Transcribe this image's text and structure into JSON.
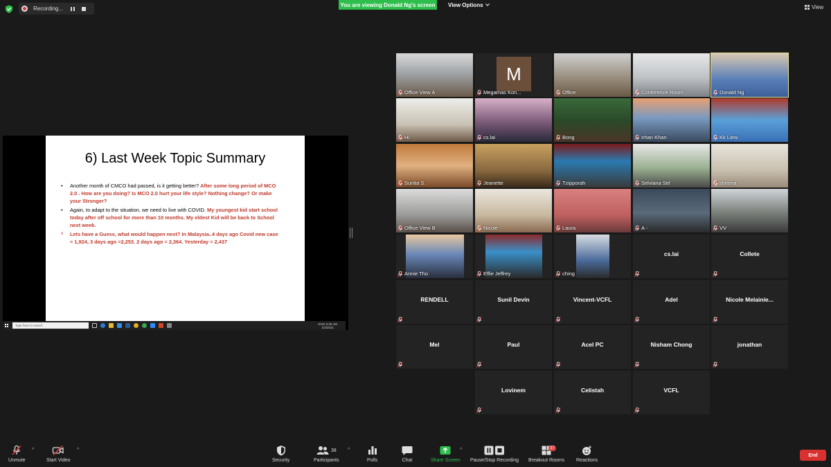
{
  "topbar": {
    "recording_label": "Recording...",
    "banner": "You are viewing Donald Ng's screen",
    "view_options": "View Options",
    "view_label": "View"
  },
  "colors": {
    "accent_green": "#2dbe4b",
    "end_red": "#d93030",
    "active_speaker": "#e8e89a"
  },
  "slide": {
    "title": "6) Last Week Topic Summary",
    "bullets": [
      {
        "normal": "Another month of CMCO had passed, is it getting better?  ",
        "red": "After some long period of MCO 2.0 .  How are you doing?  Is MCO 2.0 hurt your life style? Nothing change? Or make your Stronger?"
      },
      {
        "normal": "Again, to adapt to the situation, we need to live with COVID.  ",
        "red": "My youngest kid start school today after off school for more than 10 months.  My eldest Kid will be back to School next week."
      },
      {
        "normal": "",
        "red": "Lets have a Guess, what would happen next? In Malaysia..4 days ago Covid new case = 1,924, 3 days ago =2,253.  2 days ago = 2,364. Yesterday = 2,437"
      }
    ]
  },
  "taskbar": {
    "search": "Type here to search",
    "time": "8:30 AM",
    "date": "1/3/2021",
    "lang": "ENG"
  },
  "participants": [
    {
      "name": "Office View A"
    },
    {
      "name": "Megamas Kon...",
      "initial": "M"
    },
    {
      "name": "Office"
    },
    {
      "name": "Conference Room"
    },
    {
      "name": "Donald Ng"
    },
    {
      "name": "Hi"
    },
    {
      "name": "cs.lai"
    },
    {
      "name": "Bong"
    },
    {
      "name": "Irhan Khan"
    },
    {
      "name": "Kk Liew"
    },
    {
      "name": "Sunita S."
    },
    {
      "name": "Jeanette"
    },
    {
      "name": "Tzipporah"
    },
    {
      "name": "Selviana Sel"
    },
    {
      "name": "sheena"
    },
    {
      "name": "Office View B"
    },
    {
      "name": "Nicole"
    },
    {
      "name": "Laura"
    },
    {
      "name": "A -"
    },
    {
      "name": "VV"
    },
    {
      "name": "Annie Tho"
    },
    {
      "name": "Effie Jeffrey"
    },
    {
      "name": "ching"
    },
    {
      "name": "cs.lai"
    },
    {
      "name": "Collete"
    },
    {
      "name": "RENDELL"
    },
    {
      "name": "Sunil Devin"
    },
    {
      "name": "Vincent-VCFL"
    },
    {
      "name": "Adel"
    },
    {
      "name": "Nicole  Melainie..."
    },
    {
      "name": "Mel"
    },
    {
      "name": "Paul"
    },
    {
      "name": "Acel PC"
    },
    {
      "name": "Nisham Chong"
    },
    {
      "name": "jonathan"
    },
    {
      "name": "Lovinem"
    },
    {
      "name": "Celistah"
    },
    {
      "name": "VCFL"
    }
  ],
  "toolbar": {
    "unmute": "Unmute",
    "start_video": "Start Video",
    "security": "Security",
    "participants": "Participants",
    "participants_count": "38",
    "polls": "Polls",
    "chat": "Chat",
    "share_screen": "Share Screen",
    "pause_recording": "Pause/Stop Recording",
    "breakout_rooms": "Breakout Rooms",
    "breakout_count": "37",
    "reactions": "Reactions",
    "end": "End"
  }
}
